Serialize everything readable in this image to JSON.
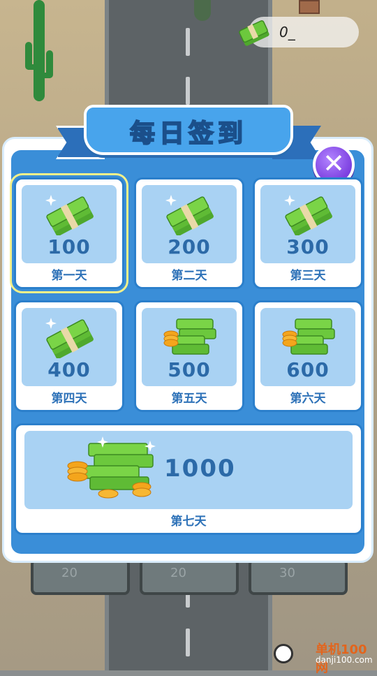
{
  "hud": {
    "cash_icon": "cash-stack-icon",
    "cash_value": "0_"
  },
  "dialog": {
    "title": "每日签到",
    "close_icon": "close-icon",
    "days": [
      {
        "amount": "100",
        "label": "第一天",
        "icon": "cash-stack-icon",
        "selected": true
      },
      {
        "amount": "200",
        "label": "第二天",
        "icon": "cash-stack-icon"
      },
      {
        "amount": "300",
        "label": "第三天",
        "icon": "cash-stack-icon"
      },
      {
        "amount": "400",
        "label": "第四天",
        "icon": "cash-stack-icon"
      },
      {
        "amount": "500",
        "label": "第五天",
        "icon": "cash-coins-icon"
      },
      {
        "amount": "600",
        "label": "第六天",
        "icon": "cash-coins-icon"
      }
    ],
    "bonus_day": {
      "amount": "1000",
      "label": "第七天",
      "icon": "cash-coins-pile-icon"
    }
  },
  "shop_peek": [
    "20",
    "20",
    "30"
  ],
  "watermark": {
    "site": "单机100网",
    "url": "danji100.com"
  },
  "colors": {
    "accent": "#3a8ed8",
    "text_blue": "#2c6aa8",
    "cash_green": "#6cc83d",
    "close_purple": "#7c3fe0"
  }
}
